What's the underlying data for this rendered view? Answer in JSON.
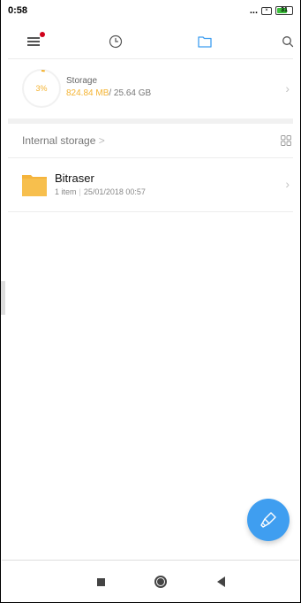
{
  "status_bar": {
    "time": "0:58",
    "dots": "...",
    "battery_level": "31",
    "colors": {
      "battery_fill": "#3bbf3b"
    }
  },
  "toolbar": {
    "menu_icon": "menu-icon",
    "recent_icon": "clock-icon",
    "folder_icon": "folder-icon",
    "search_icon": "search-icon",
    "active_tab": "folder",
    "colors": {
      "active": "#3f9ef0",
      "notification_dot": "#d0021b"
    }
  },
  "storage": {
    "percent": "3%",
    "title": "Storage",
    "used": "824.84 MB",
    "total": "/ 25.64 GB",
    "used_fraction": 0.03,
    "colors": {
      "used": "#f4b331"
    }
  },
  "path": {
    "label": "Internal storage",
    "chevron": ">",
    "view_icon": "grid-view-icon"
  },
  "files": [
    {
      "name": "Bitraser",
      "count": "1 item",
      "date": "25/01/2018 00:57",
      "icon": "folder-icon",
      "colors": {
        "folder": "#f5b43c"
      }
    }
  ],
  "fab": {
    "icon": "clean-brush-icon",
    "color": "#3f9ef0"
  },
  "nav_bar": {
    "recents_icon": "square-icon",
    "home_icon": "home-circle-icon",
    "back_icon": "back-triangle-icon"
  }
}
